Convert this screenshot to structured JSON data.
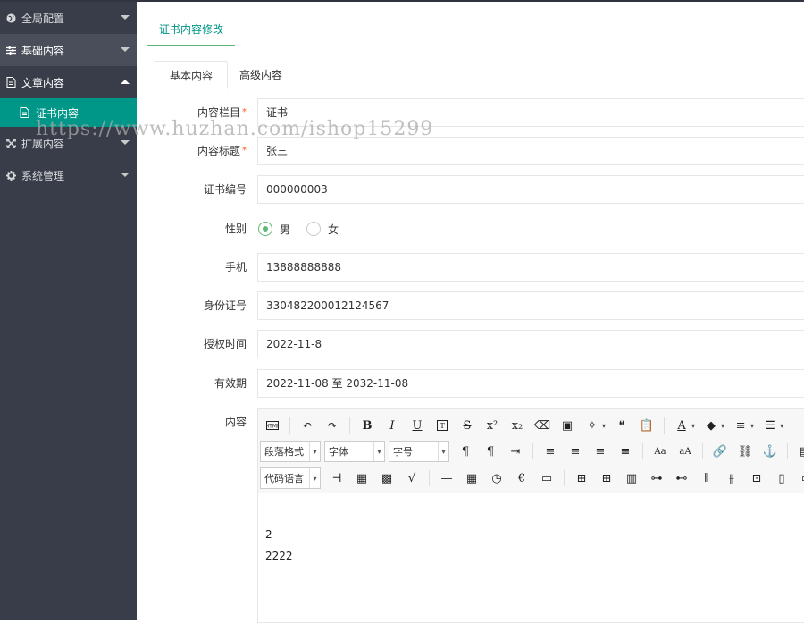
{
  "sidebar": {
    "items": [
      {
        "label": "全局配置",
        "icon": "globe-icon"
      },
      {
        "label": "基础内容",
        "icon": "sliders-icon"
      },
      {
        "label": "文章内容",
        "icon": "document-icon"
      },
      {
        "label": "扩展内容",
        "icon": "expand-icon"
      },
      {
        "label": "系统管理",
        "icon": "gear-icon"
      }
    ],
    "sub_item": {
      "label": "证书内容",
      "icon": "file-icon"
    }
  },
  "page_tab": "证书内容修改",
  "form_tabs": [
    "基本内容",
    "高级内容"
  ],
  "form": {
    "column": {
      "label": "内容栏目",
      "value": "证书",
      "required": "*"
    },
    "title": {
      "label": "内容标题",
      "value": "张三",
      "required": "*"
    },
    "cert_no": {
      "label": "证书编号",
      "value": "000000003"
    },
    "gender": {
      "label": "性别",
      "options": [
        "男",
        "女"
      ],
      "selected": "男"
    },
    "phone": {
      "label": "手机",
      "value": "13888888888"
    },
    "id_no": {
      "label": "身份证号",
      "value": "330482200012124567"
    },
    "auth_time": {
      "label": "授权时间",
      "value": "2022-11-8"
    },
    "validity": {
      "label": "有效期",
      "value": "2022-11-08 至 2032-11-08"
    },
    "content": {
      "label": "内容"
    }
  },
  "editor": {
    "paragraph_select": "段落格式",
    "font_select": "字体",
    "size_select": "字号",
    "code_select": "代码语言",
    "body_lines": [
      "2",
      "2222"
    ]
  },
  "watermark": "https://www.huzhan.com/ishop15299",
  "colors": {
    "accent": "#009688",
    "sidebar_bg": "#393d49",
    "required": "#ff5722",
    "radio": "#5fb878"
  }
}
